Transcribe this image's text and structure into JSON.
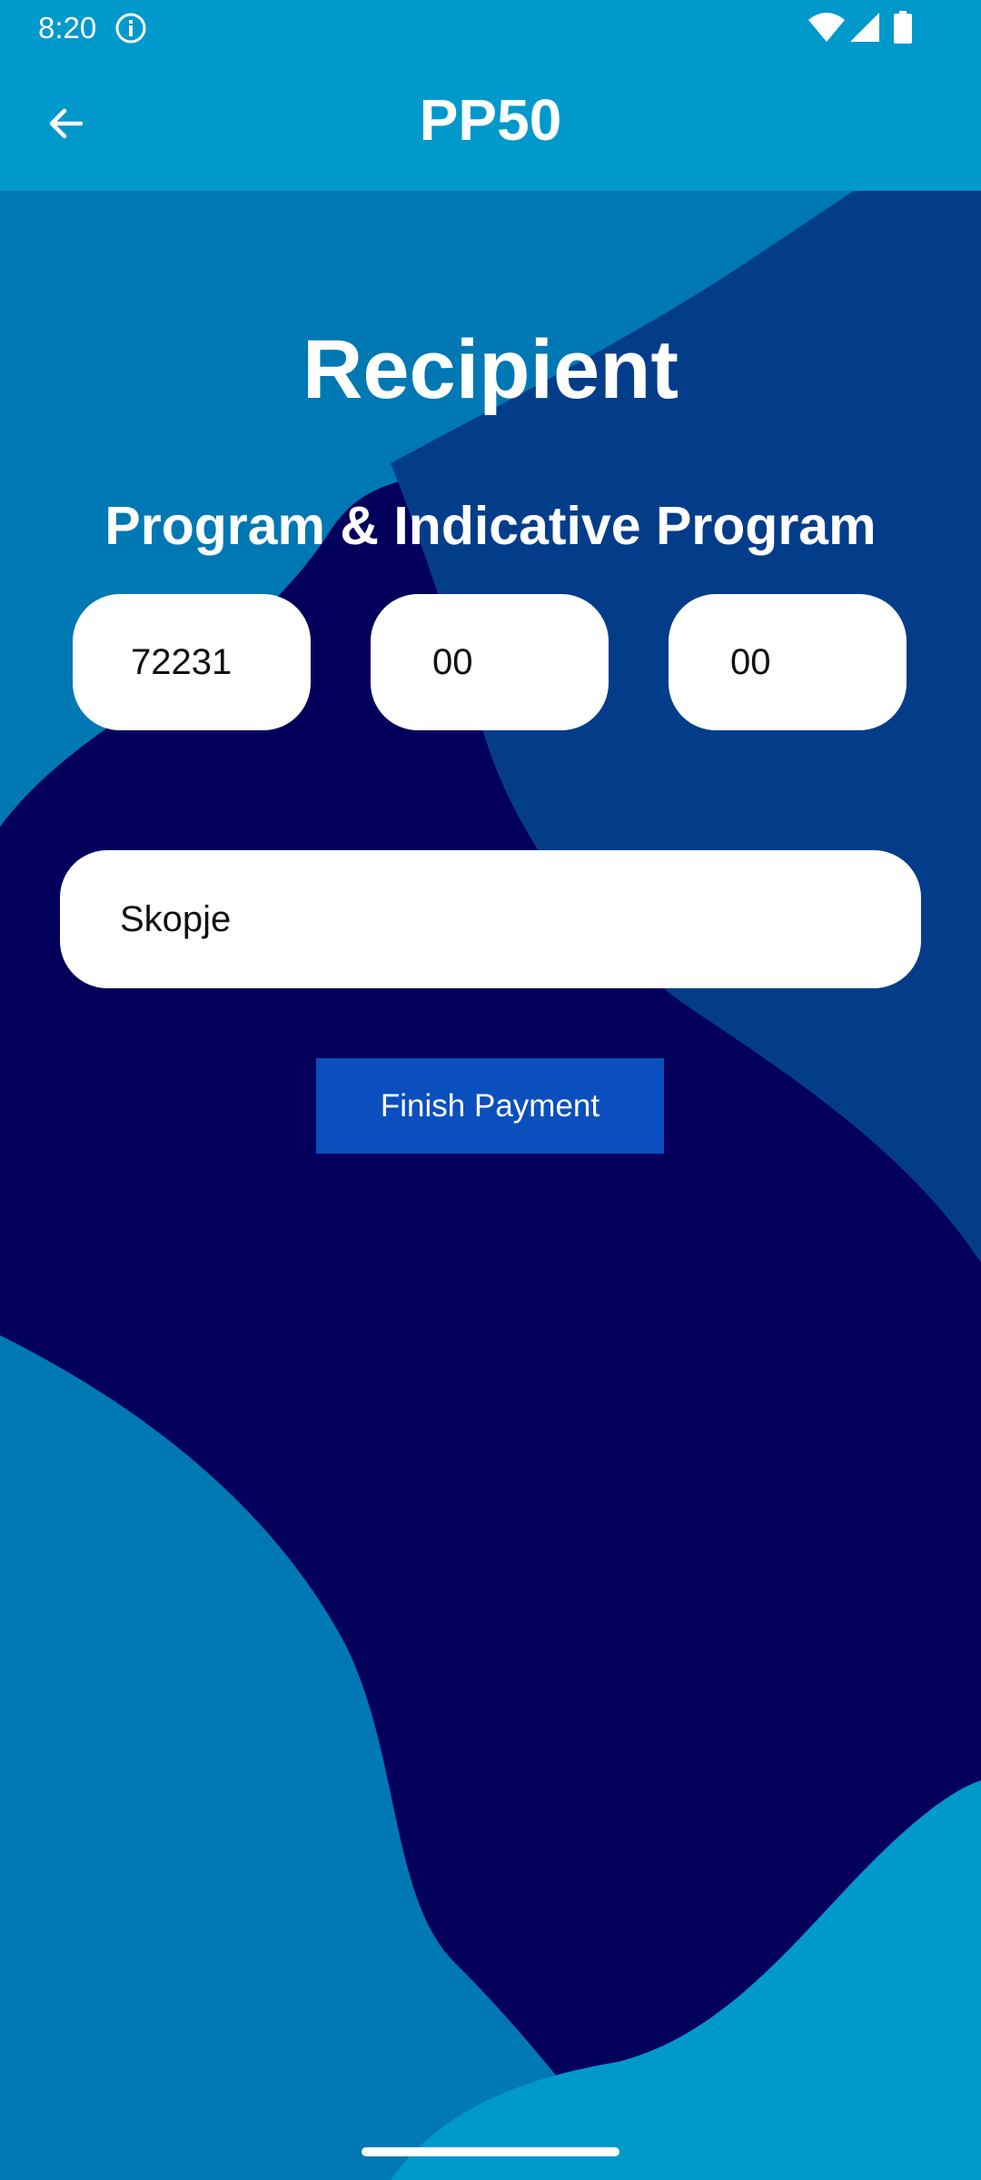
{
  "status_bar": {
    "time": "8:20",
    "icons": [
      "info-icon",
      "wifi-icon",
      "signal-icon",
      "battery-icon"
    ]
  },
  "app_bar": {
    "title": "PP50",
    "back_icon": "arrow-left-icon"
  },
  "form": {
    "heading": "Recipient",
    "subheading": "Program & Indicative Program",
    "program_code_1": "72231",
    "program_code_2": "00",
    "program_code_3": "00",
    "place": "Skopje",
    "finish_label": "Finish Payment"
  },
  "colors": {
    "app_bar": "#0099cc",
    "background_dark": "#03005c",
    "wave_mid": "#0078b4",
    "wave_navy": "#033d8a",
    "button": "#0a4fbd",
    "field": "#ffffff"
  }
}
